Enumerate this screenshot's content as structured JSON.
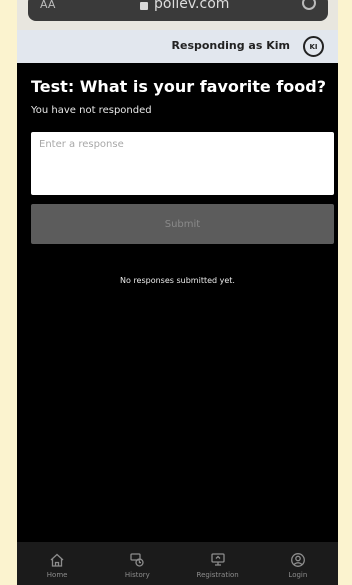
{
  "browser": {
    "text_size_label": "AA",
    "url": "pollev.com"
  },
  "responder": {
    "label": "Responding as Kim",
    "avatar_initials": "KI"
  },
  "poll": {
    "title": "Test: What is your favorite food?",
    "status": "You have not responded",
    "input_placeholder": "Enter a response",
    "input_value": "",
    "submit_label": "Submit",
    "empty_message": "No responses submitted yet."
  },
  "nav": {
    "items": [
      {
        "label": "Home",
        "icon": "home-icon"
      },
      {
        "label": "History",
        "icon": "history-icon"
      },
      {
        "label": "Registration",
        "icon": "registration-icon"
      },
      {
        "label": "Login",
        "icon": "login-icon"
      }
    ]
  },
  "colors": {
    "page_background": "#fbf3cf",
    "app_background": "#000000",
    "responder_bar": "#e2e7ee",
    "submit_disabled": "#5c5c5c",
    "nav_background": "#1b1b1b"
  }
}
